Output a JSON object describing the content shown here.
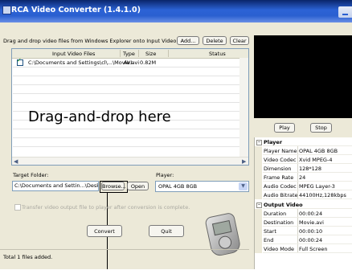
{
  "window": {
    "title": "RCA Video Converter (1.4.1.0)"
  },
  "toolbar": {
    "instruction": "Drag and drop video files from Windows Explorer onto Input Video Files...",
    "add_label": "Add...",
    "delete_label": "Delete",
    "clear_label": "Clear"
  },
  "file_list": {
    "columns": [
      "Input Video Files",
      "Type",
      "Size",
      "Status"
    ],
    "rows": [
      {
        "checked": true,
        "path": "C:\\Documents and Settings\\cl\\...\\Movie.avi",
        "type": "AVI",
        "size": "0.82M",
        "status": ""
      }
    ],
    "overlay": "Drag-and-drop here"
  },
  "target": {
    "label": "Target Folder:",
    "value": "C:\\Documents and Settin...\\Desktop",
    "browse_label": "Browse...",
    "open_label": "Open"
  },
  "player": {
    "label": "Player:",
    "selected": "OPAL 4GB 8GB"
  },
  "transfer_option": "Transfer video output file to player after conversion is complete.",
  "actions": {
    "convert_label": "Convert",
    "quit_label": "Quit"
  },
  "status": "Total 1 files added.",
  "preview": {
    "play_label": "Play",
    "stop_label": "Stop"
  },
  "properties": {
    "groups": [
      {
        "name": "Player",
        "items": [
          {
            "k": "Player Name",
            "v": "OPAL 4GB 8GB"
          },
          {
            "k": "Video Codec",
            "v": "Xvid MPEG-4"
          },
          {
            "k": "Dimension",
            "v": "128*128"
          },
          {
            "k": "Frame Rate",
            "v": "24"
          },
          {
            "k": "Audio Codec",
            "v": "MPEG Layer-3"
          },
          {
            "k": "Audio Bitrate",
            "v": "44100Hz,128kbps"
          }
        ]
      },
      {
        "name": "Output Video",
        "items": [
          {
            "k": "Duration",
            "v": "00:00:24"
          },
          {
            "k": "Destination",
            "v": "Movie.avi"
          },
          {
            "k": "Start",
            "v": "00:00:10"
          },
          {
            "k": "End",
            "v": "00:00:24"
          },
          {
            "k": "Video Mode",
            "v": "Full Screen"
          }
        ]
      }
    ]
  }
}
